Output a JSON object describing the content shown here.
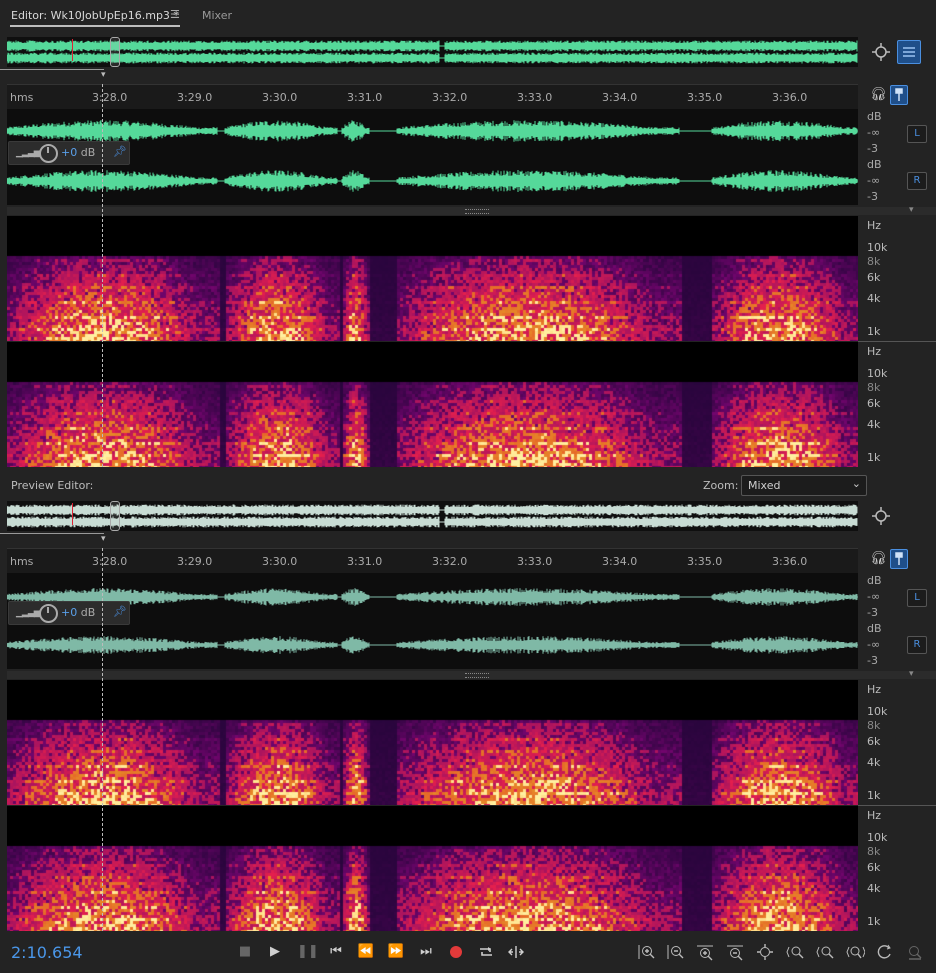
{
  "tabs": {
    "editor_label": "Editor: Wk10JobUpEp16.mp3 *",
    "mixer_label": "Mixer"
  },
  "ruler": {
    "unit": "hms",
    "ticks": [
      "3:28.0",
      "3:29.0",
      "3:30.0",
      "3:31.0",
      "3:32.0",
      "3:33.0",
      "3:34.0",
      "3:35.0",
      "3:36.0"
    ]
  },
  "amplitude_scale": {
    "unit": "dB",
    "neg_inf": "-∞",
    "minus3": "-3",
    "left_channel": "L",
    "right_channel": "R"
  },
  "volume_hud": {
    "value": "+0",
    "unit": "dB"
  },
  "spectral_scale": {
    "unit": "Hz",
    "labels": [
      "10k",
      "8k",
      "6k",
      "4k",
      "1k"
    ]
  },
  "preview": {
    "label": "Preview Editor:",
    "zoom_label": "Zoom:",
    "zoom_value": "Mixed"
  },
  "transport": {
    "time": "2:10.654",
    "buttons": [
      "stop",
      "play",
      "pause",
      "move-to-previous",
      "rewind",
      "fast-forward",
      "move-to-next",
      "record",
      "loop-playback",
      "skip-selection"
    ]
  },
  "zoom_tools": [
    "zoom-in-amplitude",
    "zoom-out-amplitude",
    "zoom-in-time",
    "zoom-out-time",
    "zoom-out-full",
    "zoom-in-selection",
    "zoom-left-edge",
    "zoom-right-edge",
    "zoom-selection",
    "zoom-reset",
    "zoom-lock"
  ],
  "colors": {
    "waveform_main": "#55d99a",
    "waveform_preview": "#7fb9a6",
    "accent_blue": "#4a96e8",
    "record_red": "#e23a3a"
  }
}
